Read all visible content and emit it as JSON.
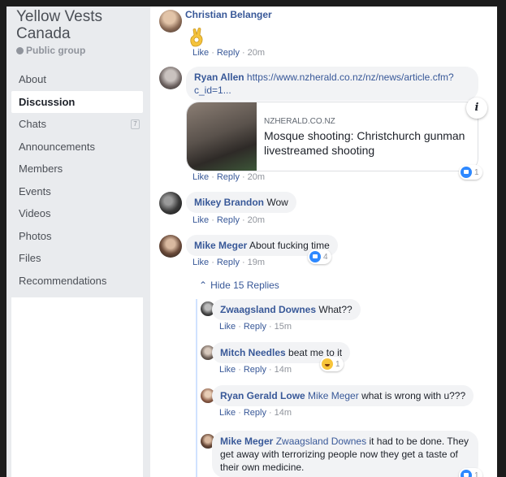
{
  "sidebar": {
    "group_name": "Yellow Vests Canada",
    "privacy": "Public group",
    "items": [
      {
        "label": "About"
      },
      {
        "label": "Discussion"
      },
      {
        "label": "Chats",
        "badge": "7"
      },
      {
        "label": "Announcements"
      },
      {
        "label": "Members"
      },
      {
        "label": "Events"
      },
      {
        "label": "Videos"
      },
      {
        "label": "Photos"
      },
      {
        "label": "Files"
      },
      {
        "label": "Recommendations"
      }
    ]
  },
  "actions": {
    "like": "Like",
    "reply": "Reply",
    "sep": "·"
  },
  "comments": [
    {
      "author": "Christian Belanger",
      "text": "",
      "emoji": "ok-hand",
      "time": "20m"
    },
    {
      "author": "Ryan Allen",
      "text": "https://www.nzherald.co.nz/nz/news/article.cfm?c_id=1...",
      "time": "20m",
      "reactions": "1",
      "link_card": {
        "source": "NZHERALD.CO.NZ",
        "title": "Mosque shooting: Christchurch gunman livestreamed shooting"
      }
    },
    {
      "author": "Mikey Brandon",
      "text": "Wow",
      "time": "20m"
    },
    {
      "author": "Mike Meger",
      "text": "About fucking time",
      "time": "19m",
      "reactions": "4"
    }
  ],
  "hide_replies": "Hide 15 Replies",
  "replies": [
    {
      "author": "Zwaagsland Downes",
      "text": "What??",
      "time": "15m"
    },
    {
      "author": "Mitch Needles",
      "text": "beat me to it",
      "time": "14m",
      "reactions": "1"
    },
    {
      "author": "Ryan Gerald Lowe",
      "mention": "Mike Meger",
      "text": "what is wrong with u???",
      "time": "14m"
    },
    {
      "author": "Mike Meger",
      "mention": "Zwaagsland Downes",
      "text": "it had to be done. They get away with terrorizing people now they get a taste of their own medicine.",
      "reactions": "1"
    }
  ],
  "colors": {
    "link": "#385898",
    "bubble": "#f2f3f5",
    "like": "#2d88ff"
  }
}
